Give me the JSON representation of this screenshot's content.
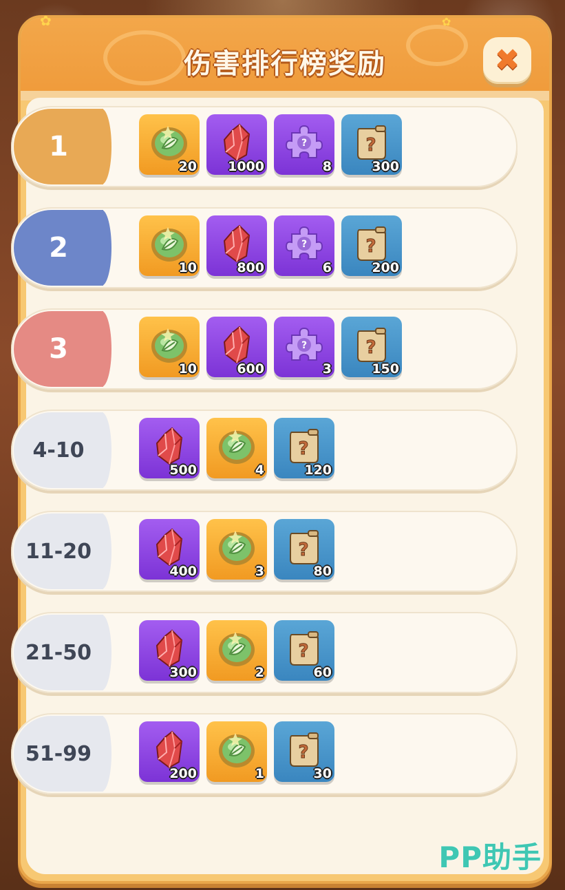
{
  "header": {
    "title": "伤害排行榜奖励",
    "close_glyph": "✖"
  },
  "colors": {
    "rank_1": "#e8a955",
    "rank_2": "#6d86c9",
    "rank_3": "#e58a84",
    "rank_other": "#e6e8ee",
    "panel_border": "#f3a74a"
  },
  "rows": [
    {
      "rank": "1",
      "style": "gold",
      "rewards": [
        {
          "icon": "seed-orb-icon",
          "bg": "gold",
          "qty": "20"
        },
        {
          "icon": "red-crystal-icon",
          "bg": "purple",
          "qty": "1000"
        },
        {
          "icon": "puzzle-piece-icon",
          "bg": "purple",
          "qty": "8"
        },
        {
          "icon": "mystery-scroll-icon",
          "bg": "blue",
          "qty": "300"
        }
      ]
    },
    {
      "rank": "2",
      "style": "blue",
      "rewards": [
        {
          "icon": "seed-orb-icon",
          "bg": "gold",
          "qty": "10"
        },
        {
          "icon": "red-crystal-icon",
          "bg": "purple",
          "qty": "800"
        },
        {
          "icon": "puzzle-piece-icon",
          "bg": "purple",
          "qty": "6"
        },
        {
          "icon": "mystery-scroll-icon",
          "bg": "blue",
          "qty": "200"
        }
      ]
    },
    {
      "rank": "3",
      "style": "red",
      "rewards": [
        {
          "icon": "seed-orb-icon",
          "bg": "gold",
          "qty": "10"
        },
        {
          "icon": "red-crystal-icon",
          "bg": "purple",
          "qty": "600"
        },
        {
          "icon": "puzzle-piece-icon",
          "bg": "purple",
          "qty": "3"
        },
        {
          "icon": "mystery-scroll-icon",
          "bg": "blue",
          "qty": "150"
        }
      ]
    },
    {
      "rank": "4-10",
      "style": "plain",
      "rewards": [
        {
          "icon": "red-crystal-icon",
          "bg": "purple",
          "qty": "500"
        },
        {
          "icon": "seed-orb-icon",
          "bg": "gold",
          "qty": "4"
        },
        {
          "icon": "mystery-scroll-icon",
          "bg": "blue",
          "qty": "120"
        }
      ]
    },
    {
      "rank": "11-20",
      "style": "plain",
      "rewards": [
        {
          "icon": "red-crystal-icon",
          "bg": "purple",
          "qty": "400"
        },
        {
          "icon": "seed-orb-icon",
          "bg": "gold",
          "qty": "3"
        },
        {
          "icon": "mystery-scroll-icon",
          "bg": "blue",
          "qty": "80"
        }
      ]
    },
    {
      "rank": "21-50",
      "style": "plain",
      "rewards": [
        {
          "icon": "red-crystal-icon",
          "bg": "purple",
          "qty": "300"
        },
        {
          "icon": "seed-orb-icon",
          "bg": "gold",
          "qty": "2"
        },
        {
          "icon": "mystery-scroll-icon",
          "bg": "blue",
          "qty": "60"
        }
      ]
    },
    {
      "rank": "51-99",
      "style": "plain",
      "rewards": [
        {
          "icon": "red-crystal-icon",
          "bg": "purple",
          "qty": "200"
        },
        {
          "icon": "seed-orb-icon",
          "bg": "gold",
          "qty": "1"
        },
        {
          "icon": "mystery-scroll-icon",
          "bg": "blue",
          "qty": "30"
        }
      ]
    }
  ],
  "watermark": "PP助手"
}
